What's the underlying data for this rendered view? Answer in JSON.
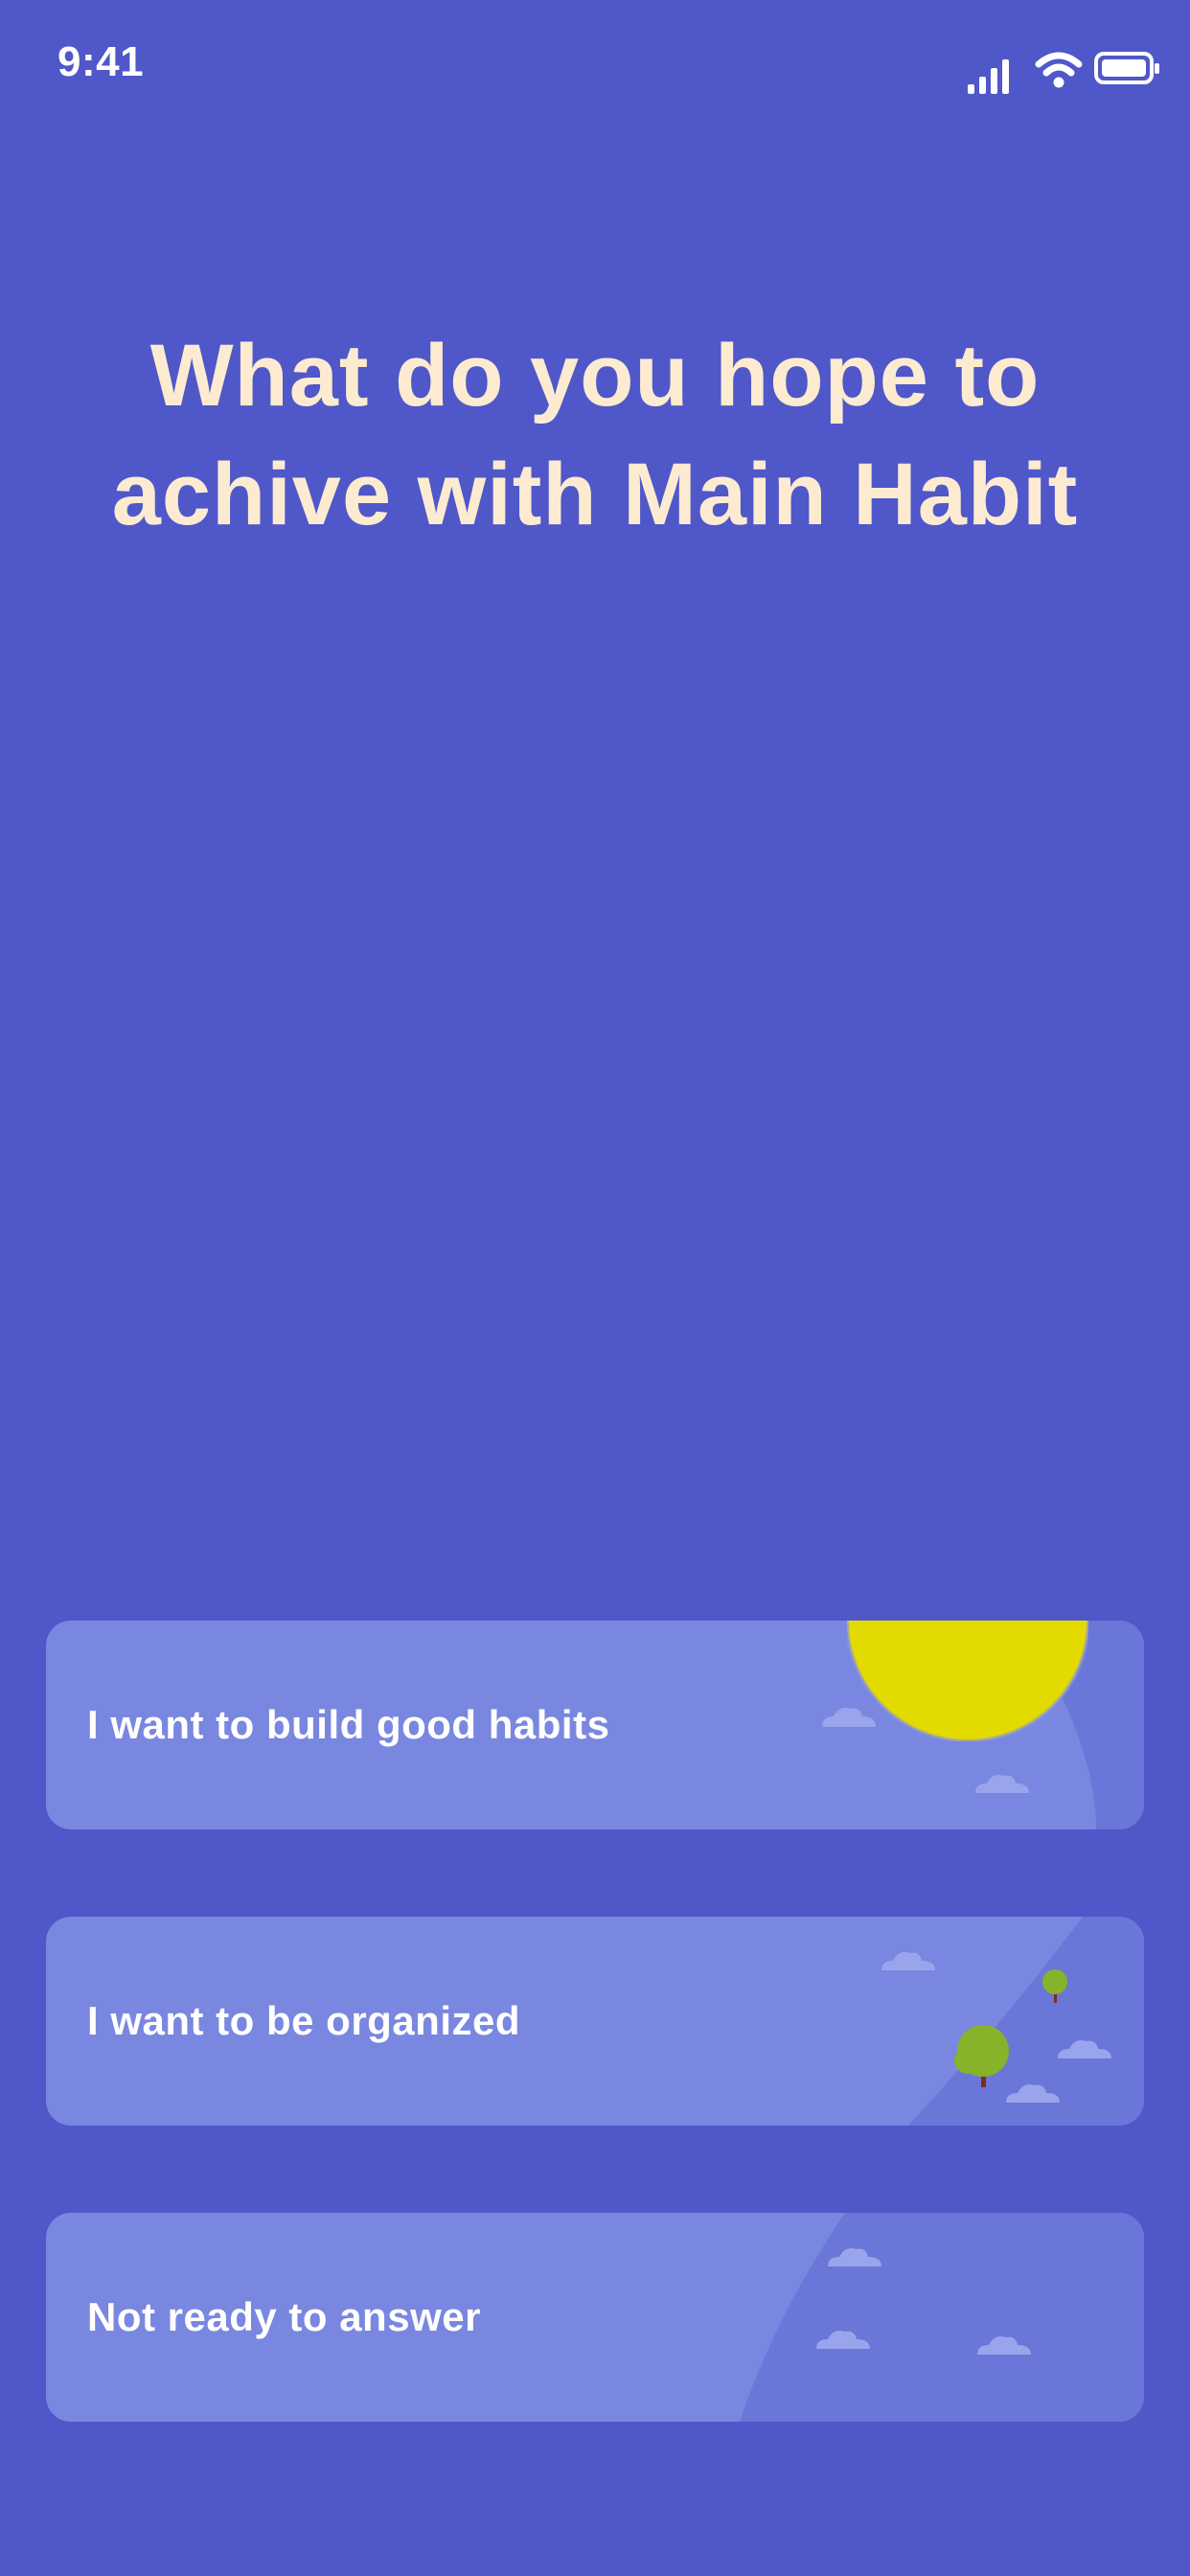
{
  "status_bar": {
    "time": "9:41",
    "icons": [
      "cellular-signal-icon",
      "wifi-icon",
      "battery-icon"
    ]
  },
  "headline": "What do you hope to achive with Main Habit",
  "options": [
    {
      "label": "I want to build good habits"
    },
    {
      "label": "I want to be organized"
    },
    {
      "label": "Not ready to answer"
    }
  ],
  "colors": {
    "background": "#4F57C9",
    "headline": "#FCEBD0",
    "card": "#7987E0",
    "card_shade": "#6A76D8",
    "sun": "#E3DB00",
    "tree": "#86B32A",
    "trunk": "#7A2E1E",
    "cloud": "#9AA4EC"
  }
}
